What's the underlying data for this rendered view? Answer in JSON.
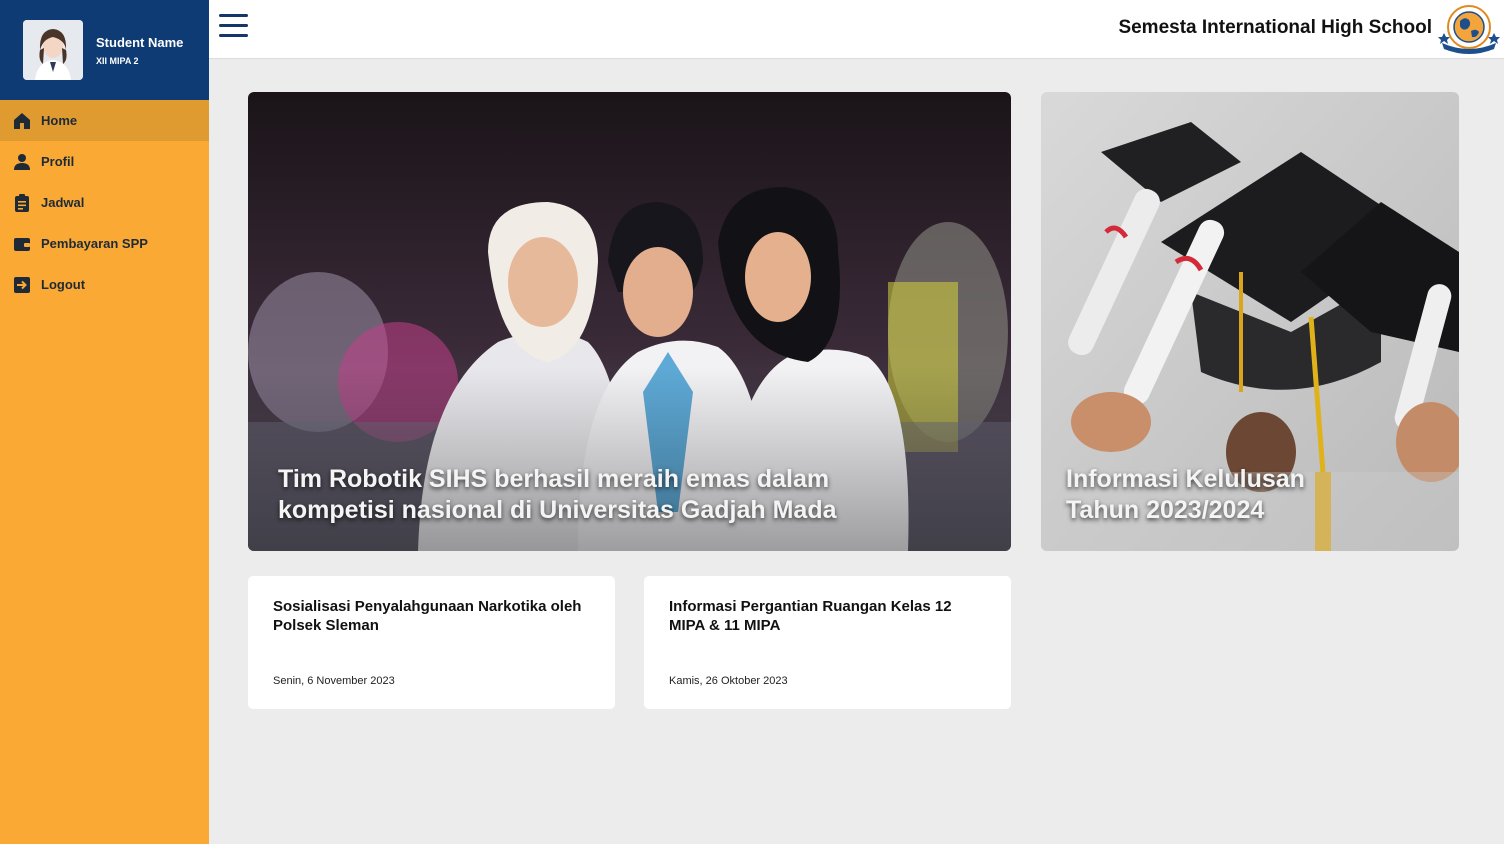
{
  "profile": {
    "name": "Student Name",
    "class": "XII MIPA 2"
  },
  "sidebar": {
    "items": [
      {
        "label": "Home",
        "icon": "home-icon",
        "active": true
      },
      {
        "label": "Profil",
        "icon": "user-icon",
        "active": false
      },
      {
        "label": "Jadwal",
        "icon": "clipboard-icon",
        "active": false
      },
      {
        "label": "Pembayaran SPP",
        "icon": "wallet-icon",
        "active": false
      },
      {
        "label": "Logout",
        "icon": "logout-icon",
        "active": false
      }
    ]
  },
  "header": {
    "school_name": "Semesta International High School",
    "logo_icon": "school-globe-logo"
  },
  "featured": [
    {
      "caption": "Tim Robotik SIHS berhasil meraih emas dalam kompetisi nasional di Universitas Gadjah Mada"
    },
    {
      "caption": "Informasi Kelulusan Tahun 2023/2024"
    }
  ],
  "news": [
    {
      "title": "Sosialisasi Penyalahgunaan Narkotika oleh Polsek Sleman",
      "date": "Senin, 6 November 2023"
    },
    {
      "title": "Informasi Pergantian Ruangan Kelas 12 MIPA & 11 MIPA",
      "date": "Kamis, 26 Oktober 2023"
    }
  ],
  "colors": {
    "sidebar": "#f9a934",
    "sidebar_active": "#e09b30",
    "profile_bg": "#0e3b74",
    "accent": "#14366b"
  }
}
